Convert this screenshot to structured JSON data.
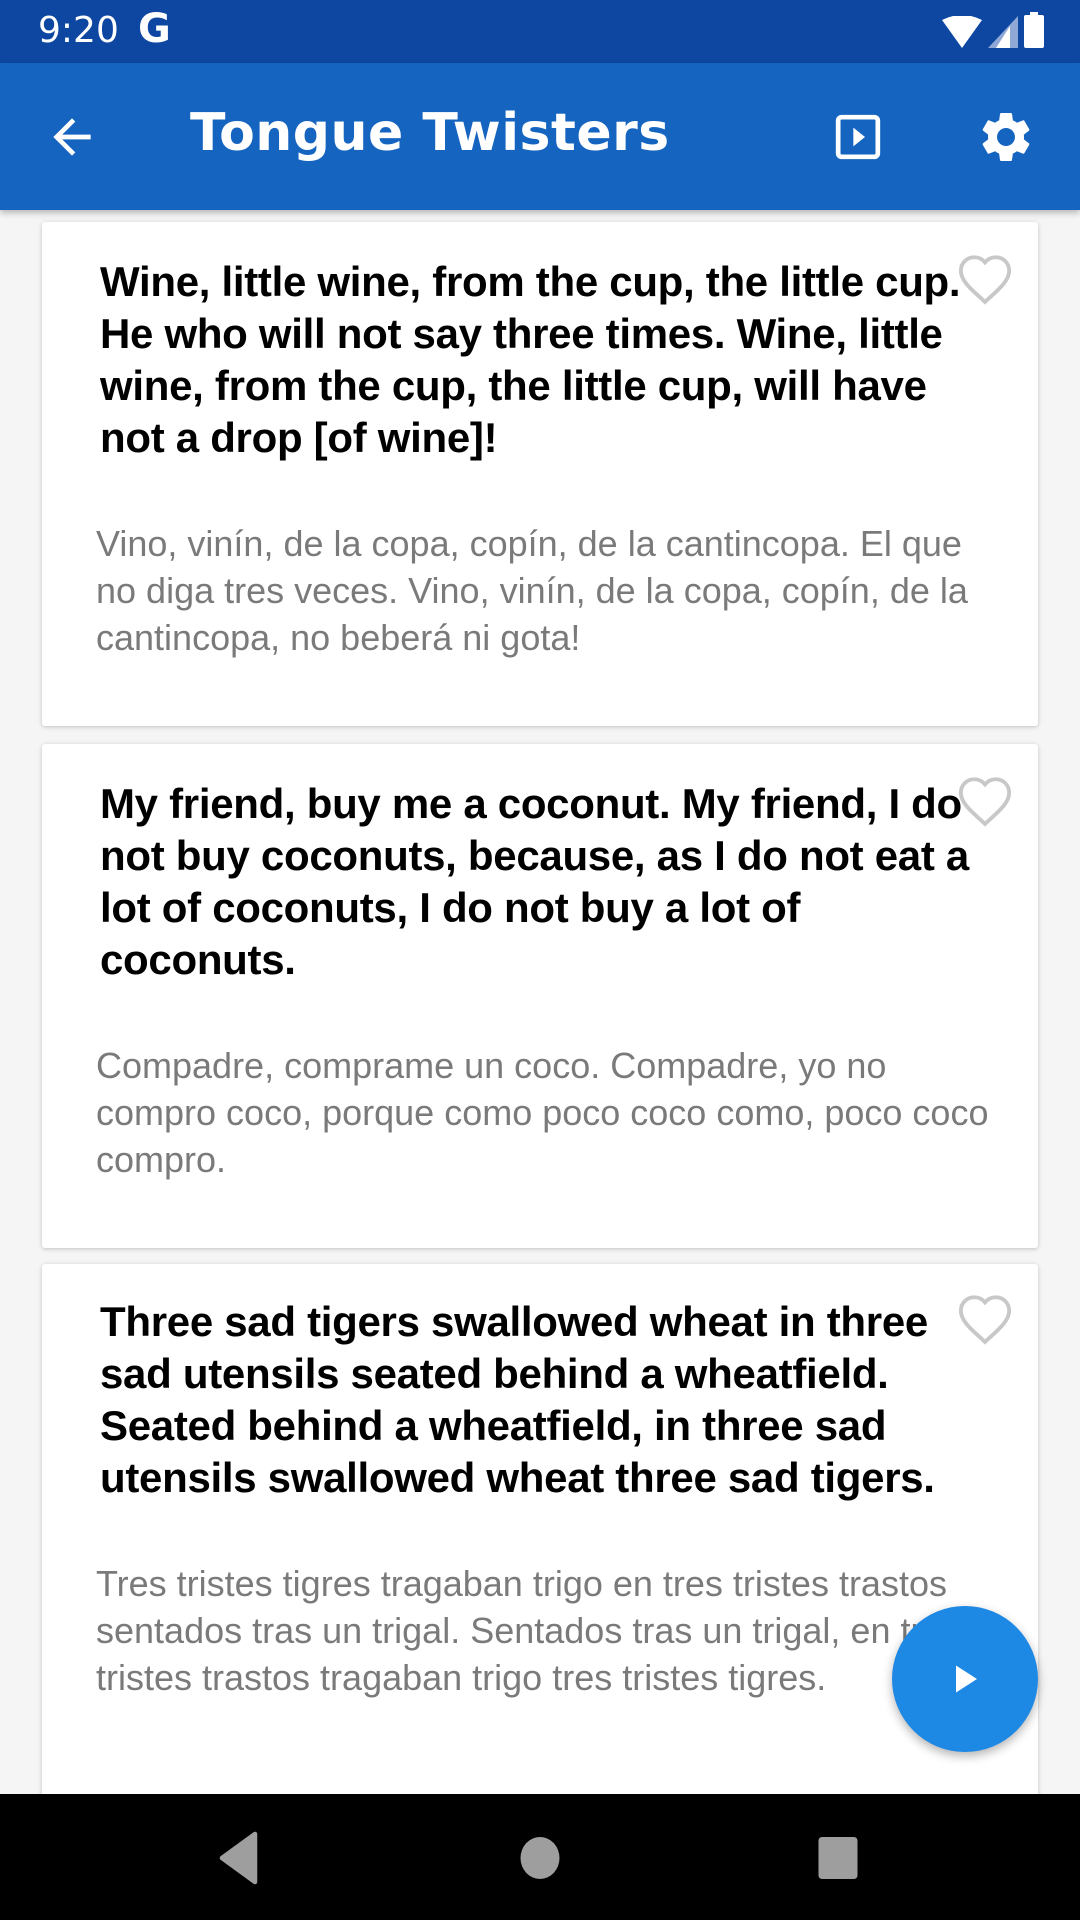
{
  "status_bar": {
    "time": "9:20",
    "notification_icon": "G",
    "icons": [
      "wifi-icon",
      "cell-signal-icon",
      "battery-icon"
    ]
  },
  "app_bar": {
    "title": "Tongue Twisters",
    "back_icon": "arrow-back-icon",
    "actions": [
      "slideshow-icon",
      "settings-icon"
    ],
    "color": "#1565c0",
    "status_color": "#0d47a1"
  },
  "cards": [
    {
      "english": "Wine, little wine, from the cup, the little cup. He who will not say three times. Wine, little wine, from the cup, the little cup, will have not a drop [of wine]!",
      "spanish": "Vino, vinín, de la copa, copín, de la cantincopa. El que no diga tres veces. Vino, vinín, de la copa, copín, de la cantincopa, no beberá ni gota!",
      "favorite": false
    },
    {
      "english": "My friend, buy me a coconut. My friend, I do not buy coconuts, because, as I do not eat a lot of coconuts, I do not buy a lot of coconuts.",
      "spanish": "Compadre, comprame un coco. Compadre, yo no compro coco, porque como poco coco como, poco coco compro.",
      "favorite": false
    },
    {
      "english": "Three sad tigers swallowed wheat in three sad utensils seated behind a wheatfield. Seated behind a wheatfield, in three sad utensils swallowed wheat three sad tigers.",
      "spanish": "Tres tristes tigres tragaban trigo en tres tristes trastos sentados tras un trigal. Sentados tras un trigal, en tres tristes trastos tragaban trigo tres tristes tigres.",
      "favorite": false
    }
  ],
  "fab": {
    "icon": "play-icon",
    "color": "#1e88e5"
  },
  "nav_bar": {
    "buttons": [
      "back-triangle-icon",
      "home-circle-icon",
      "recents-square-icon"
    ]
  }
}
